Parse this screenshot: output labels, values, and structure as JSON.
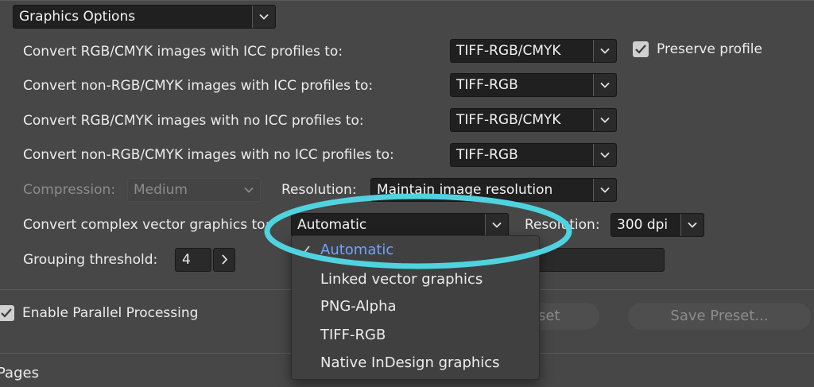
{
  "section": {
    "select_value": "Graphics Options"
  },
  "rows": {
    "rgb_icc": {
      "label": "Convert RGB/CMYK images with ICC profiles to:",
      "value": "TIFF-RGB/CMYK"
    },
    "non_rgb_icc": {
      "label": "Convert non-RGB/CMYK images with ICC profiles to:",
      "value": "TIFF-RGB"
    },
    "rgb_no_icc": {
      "label": "Convert RGB/CMYK images with no ICC profiles to:",
      "value": "TIFF-RGB/CMYK"
    },
    "non_rgb_no_icc": {
      "label": "Convert non-RGB/CMYK images with no ICC profiles to:",
      "value": "TIFF-RGB"
    }
  },
  "preserve_profile": {
    "label": "Preserve profile",
    "checked": true
  },
  "compression": {
    "label": "Compression:",
    "value": "Medium",
    "enabled": false
  },
  "resolution_image": {
    "label": "Resolution:",
    "value": "Maintain image resolution"
  },
  "vector": {
    "label": "Convert complex vector graphics to:",
    "value": "Automatic"
  },
  "resolution_vector": {
    "label": "Resolution:",
    "value": "300 dpi"
  },
  "grouping": {
    "label": "Grouping threshold:",
    "value": "4"
  },
  "parallel": {
    "label": "Enable Parallel Processing",
    "checked": true
  },
  "buttons": {
    "reset": "set",
    "save_preset": "Save Preset..."
  },
  "pages_label": "Pages",
  "dropdown": {
    "items": [
      {
        "label": "Automatic",
        "selected": true
      },
      {
        "label": "Linked vector graphics",
        "selected": false
      },
      {
        "label": "PNG-Alpha",
        "selected": false
      },
      {
        "label": "TIFF-RGB",
        "selected": false
      },
      {
        "label": "Native InDesign graphics",
        "selected": false
      }
    ]
  },
  "colors": {
    "background": "#474747",
    "field": "#202020",
    "selected_item": "#6fa5ff",
    "highlight_ring": "#4fd3df"
  }
}
